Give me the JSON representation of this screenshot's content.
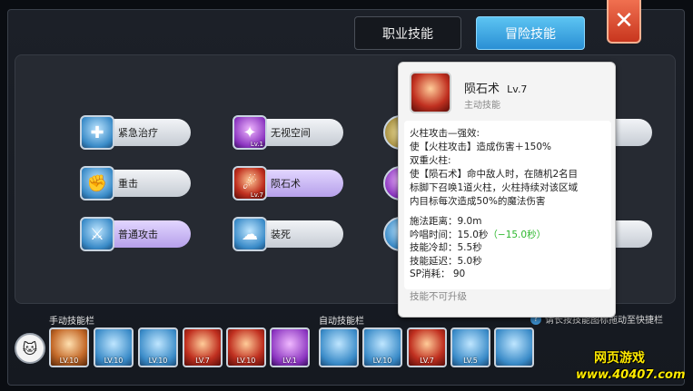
{
  "tabs": {
    "job": "职业技能",
    "adventure": "冒险技能"
  },
  "close_icon": "✕",
  "skills": [
    {
      "label": "紧急治疗",
      "icon": "heal-icon",
      "level": ""
    },
    {
      "label": "无视空间",
      "icon": "space-icon",
      "level": "Lv.1"
    },
    {
      "label": "重击",
      "icon": "strike-icon",
      "level": ""
    },
    {
      "label": "陨石术",
      "icon": "meteor-icon",
      "level": "Lv.7"
    },
    {
      "label": "普通攻击",
      "icon": "attack-icon",
      "level": ""
    },
    {
      "label": "装死",
      "icon": "play-dead-icon",
      "level": ""
    }
  ],
  "tooltip": {
    "name": "陨石术",
    "level": "Lv.7",
    "type": "主动技能",
    "desc_lines": [
      "火柱攻击—强效:",
      "使【火柱攻击】造成伤害＋150%",
      "双重火柱:",
      "使【陨石术】命中敌人时，在随机2名目",
      "标脚下召唤1道火柱，火柱持续对该区域",
      "内目标每次造成50%的魔法伤害"
    ],
    "stats": {
      "range": "施法距离：9.0m",
      "cast": "吟唱时间：15.0秒",
      "cast_bonus": "（−15.0秒）",
      "cooldown": "技能冷却：5.5秒",
      "delay": "技能延迟：5.0秒",
      "sp": "SP消耗：  90"
    },
    "footer": "技能不可升级"
  },
  "bars": {
    "manual_label": "手动技能栏",
    "auto_label": "自动技能栏",
    "hint": "请长按技能图标拖动至快捷栏"
  },
  "manual_slots": [
    {
      "level": "LV.10",
      "icon": "fire-punch-icon",
      "style": "orange"
    },
    {
      "level": "LV.10",
      "icon": "ice-ring-icon",
      "style": "blue"
    },
    {
      "level": "LV.10",
      "icon": "lightning-icon",
      "style": "blue"
    },
    {
      "level": "LV.7",
      "icon": "meteor-icon",
      "style": "red"
    },
    {
      "level": "LV.10",
      "icon": "fire-wall-icon",
      "style": "red"
    },
    {
      "level": "LV.1",
      "icon": "space-icon",
      "style": "purple"
    }
  ],
  "auto_slots": [
    {
      "level": "",
      "icon": "heal-icon",
      "style": "blue"
    },
    {
      "level": "LV.10",
      "icon": "light-icon",
      "style": "blue"
    },
    {
      "level": "LV.7",
      "icon": "meteor-icon",
      "style": "red"
    },
    {
      "level": "LV.5",
      "icon": "guard-icon",
      "style": "blue"
    },
    {
      "level": "",
      "icon": "attack-icon",
      "style": "blue"
    }
  ],
  "watermark": {
    "title": "网页游戏",
    "url": "www.40407.com"
  }
}
